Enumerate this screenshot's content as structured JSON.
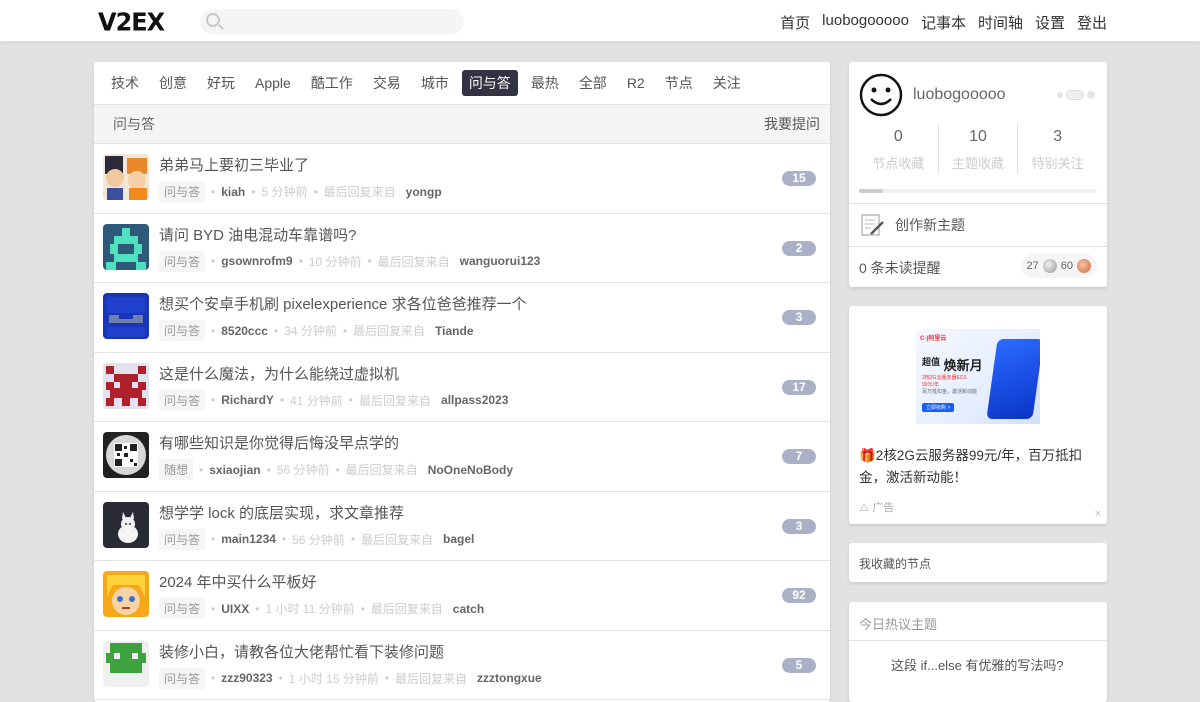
{
  "header": {
    "logo": "V2EX",
    "nav": [
      "首页",
      "luobogooooo",
      "记事本",
      "时间轴",
      "设置",
      "登出"
    ]
  },
  "tabs": [
    "技术",
    "创意",
    "好玩",
    "Apple",
    "酷工作",
    "交易",
    "城市",
    "问与答",
    "最热",
    "全部",
    "R2",
    "节点",
    "关注"
  ],
  "active_tab": "问与答",
  "subbar": {
    "node": "问与答",
    "ask": "我要提问"
  },
  "topics": [
    {
      "title": "弟弟马上要初三毕业了",
      "node": "问与答",
      "author": "kiah",
      "time": "5 分钟前",
      "last_prefix": "最后回复来自",
      "last": "yongp",
      "count": "15"
    },
    {
      "title": "请问 BYD 油电混动车靠谱吗?",
      "node": "问与答",
      "author": "gsownrofm9",
      "time": "10 分钟前",
      "last_prefix": "最后回复来自",
      "last": "wanguorui123",
      "count": "2"
    },
    {
      "title": "想买个安卓手机刷 pixelexperience 求各位爸爸推荐一个",
      "node": "问与答",
      "author": "8520ccc",
      "time": "34 分钟前",
      "last_prefix": "最后回复来自",
      "last": "Tiande",
      "count": "3"
    },
    {
      "title": "这是什么魔法，为什么能绕过虚拟机",
      "node": "问与答",
      "author": "RichardY",
      "time": "41 分钟前",
      "last_prefix": "最后回复来自",
      "last": "allpass2023",
      "count": "17"
    },
    {
      "title": "有哪些知识是你觉得后悔没早点学的",
      "node": "随想",
      "author": "sxiaojian",
      "time": "56 分钟前",
      "last_prefix": "最后回复来自",
      "last": "NoOneNoBody",
      "count": "7"
    },
    {
      "title": "想学学 lock 的底层实现，求文章推荐",
      "node": "问与答",
      "author": "main1234",
      "time": "56 分钟前",
      "last_prefix": "最后回复来自",
      "last": "bagel",
      "count": "3"
    },
    {
      "title": "2024 年中买什么平板好",
      "node": "问与答",
      "author": "UIXX",
      "time": "1 小时 11 分钟前",
      "last_prefix": "最后回复来自",
      "last": "catch",
      "count": "92"
    },
    {
      "title": "装修小白，请教各位大佬帮忙看下装修问题",
      "node": "问与答",
      "author": "zzz90323",
      "time": "1 小时 15 分钟前",
      "last_prefix": "最后回复来自",
      "last": "zzztongxue",
      "count": "5"
    }
  ],
  "profile": {
    "username": "luobogooooo",
    "stats": [
      {
        "num": "0",
        "label": "节点收藏"
      },
      {
        "num": "10",
        "label": "主题收藏"
      },
      {
        "num": "3",
        "label": "特别关注"
      }
    ],
    "progress": 0.1,
    "create_topic": "创作新主题",
    "unread": "0 条未读提醒",
    "silver": "27",
    "bronze": "60"
  },
  "ad": {
    "brand": "C-)阿里云",
    "headline1": "超值",
    "headline2": "焕新月",
    "sub1": "2核2G云服务器ECS",
    "sub2": "99元/年",
    "sub3": "百万抵扣金，激活新动能",
    "cta": "立即抢购 >",
    "text": "🎁2核2G云服务器99元/年，百万抵扣金，激活新动能！",
    "label": "广告",
    "close": "×"
  },
  "fav_nodes": "我收藏的节点",
  "hot": {
    "heading": "今日热议主题",
    "first": "这段 if...else 有优雅的写法吗?"
  }
}
